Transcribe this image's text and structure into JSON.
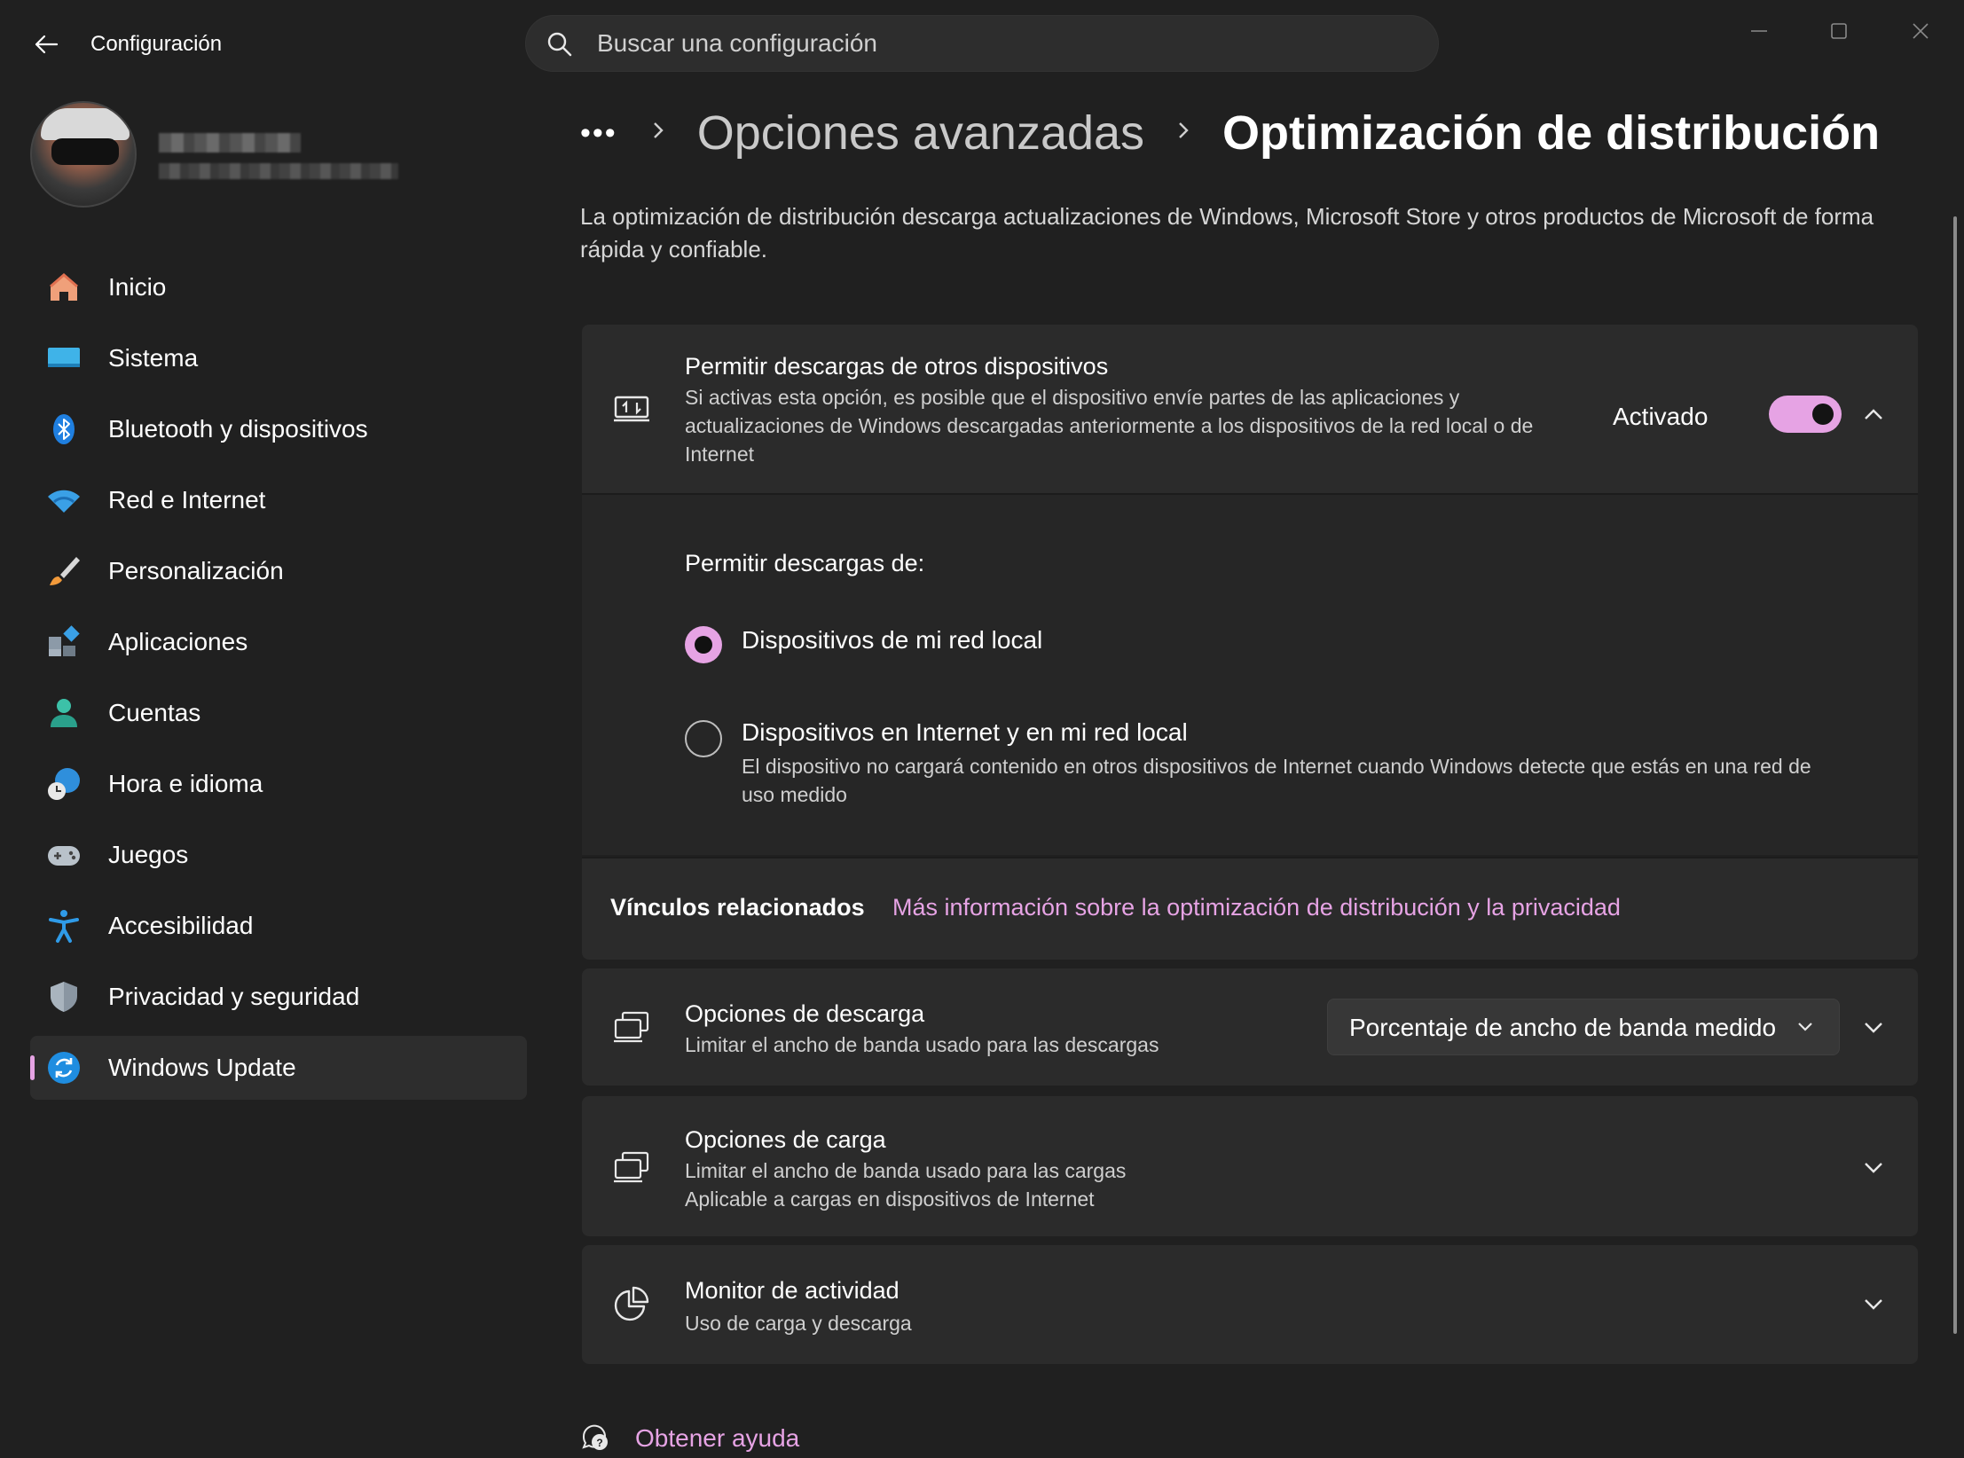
{
  "app": {
    "title": "Configuración",
    "search": {
      "placeholder": "Buscar una configuración"
    }
  },
  "sidebar": {
    "items": [
      {
        "label": "Inicio",
        "icon": "home-icon"
      },
      {
        "label": "Sistema",
        "icon": "display-icon"
      },
      {
        "label": "Bluetooth y dispositivos",
        "icon": "bluetooth-icon"
      },
      {
        "label": "Red e Internet",
        "icon": "wifi-icon"
      },
      {
        "label": "Personalización",
        "icon": "brush-icon"
      },
      {
        "label": "Aplicaciones",
        "icon": "apps-icon"
      },
      {
        "label": "Cuentas",
        "icon": "person-icon"
      },
      {
        "label": "Hora e idioma",
        "icon": "clock-globe-icon"
      },
      {
        "label": "Juegos",
        "icon": "gamepad-icon"
      },
      {
        "label": "Accesibilidad",
        "icon": "accessibility-icon"
      },
      {
        "label": "Privacidad y seguridad",
        "icon": "shield-icon"
      },
      {
        "label": "Windows Update",
        "icon": "update-icon",
        "active": true
      }
    ]
  },
  "breadcrumb": {
    "ellipsis": "•••",
    "parent": "Opciones avanzadas",
    "current": "Optimización de distribución"
  },
  "intro": "La optimización de distribución descarga actualizaciones de Windows, Microsoft Store y otros productos de Microsoft de forma rápida y confiable.",
  "allow_downloads": {
    "title": "Permitir descargas de otros dispositivos",
    "description": "Si activas esta opción, es posible que el dispositivo envíe partes de las aplicaciones y actualizaciones de Windows descargadas anteriormente a los dispositivos de la red local o de Internet",
    "toggle_state": "Activado",
    "toggle_on": true,
    "allow_from_label": "Permitir descargas de:",
    "options": [
      {
        "label": "Dispositivos de mi red local",
        "selected": true
      },
      {
        "label": "Dispositivos en Internet y en mi red local",
        "description": "El dispositivo no cargará contenido en otros dispositivos de Internet cuando Windows detecte que estás en una red de uso medido",
        "selected": false
      }
    ]
  },
  "related": {
    "title": "Vínculos relacionados",
    "link": "Más información sobre la optimización de distribución y la privacidad"
  },
  "download_options": {
    "title": "Opciones de descarga",
    "description": "Limitar el ancho de banda usado para las descargas",
    "dropdown_value": "Porcentaje de ancho de banda medido"
  },
  "upload_options": {
    "title": "Opciones de carga",
    "description_1": "Limitar el ancho de banda usado para las cargas",
    "description_2": "Aplicable a cargas en dispositivos de Internet"
  },
  "activity_monitor": {
    "title": "Monitor de actividad",
    "description": "Uso de carga y descarga"
  },
  "help": {
    "label": "Obtener ayuda"
  },
  "colors": {
    "accent": "#e6a3e4",
    "background": "#202020",
    "card": "#2b2b2b"
  }
}
